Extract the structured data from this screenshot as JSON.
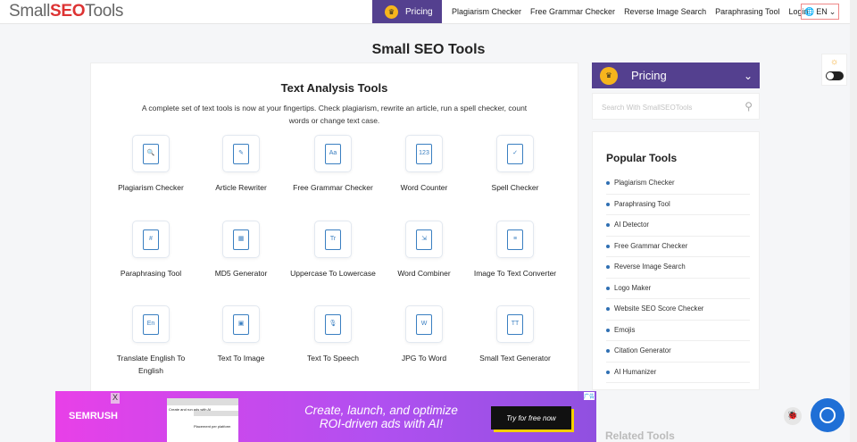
{
  "header": {
    "logo": {
      "pre": "Small",
      "seo": "SEO",
      "post": "Tools"
    },
    "pricing": "Pricing",
    "links": [
      "Plagiarism Checker",
      "Free Grammar Checker",
      "Reverse Image Search",
      "Paraphrasing Tool",
      "Login"
    ],
    "language": "EN"
  },
  "page_title": "Small SEO Tools",
  "main": {
    "title": "Text Analysis Tools",
    "description": "A complete set of text tools is now at your fingertips. Check plagiarism, rewrite an article, run a spell checker, count words or change text case.",
    "tools": [
      {
        "label": "Plagiarism Checker",
        "glyph": "🔍"
      },
      {
        "label": "Article Rewriter",
        "glyph": "✎"
      },
      {
        "label": "Free Grammar Checker",
        "glyph": "Aa"
      },
      {
        "label": "Word Counter",
        "glyph": "123"
      },
      {
        "label": "Spell Checker",
        "glyph": "✓"
      },
      {
        "label": "Paraphrasing Tool",
        "glyph": "#"
      },
      {
        "label": "MD5 Generator",
        "glyph": "▦"
      },
      {
        "label": "Uppercase To Lowercase",
        "glyph": "Tr"
      },
      {
        "label": "Word Combiner",
        "glyph": "⇲"
      },
      {
        "label": "Image To Text Converter",
        "glyph": "≡"
      },
      {
        "label": "Translate English To English",
        "glyph": "En"
      },
      {
        "label": "Text To Image",
        "glyph": "▣"
      },
      {
        "label": "Text To Speech",
        "glyph": "🎙"
      },
      {
        "label": "JPG To Word",
        "glyph": "W"
      },
      {
        "label": "Small Text Generator",
        "glyph": "TT"
      }
    ]
  },
  "sidebar": {
    "pricing": "Pricing",
    "search_placeholder": "Search With SmallSEOTools",
    "popular_title": "Popular Tools",
    "popular": [
      "Plagiarism Checker",
      "Paraphrasing Tool",
      "AI Detector",
      "Free Grammar Checker",
      "Reverse Image Search",
      "Logo Maker",
      "Website SEO Score Checker",
      "Emojis",
      "Citation Generator",
      "AI Humanizer"
    ],
    "related_title": "Related Tools"
  },
  "ad": {
    "close": "X",
    "brand": "SEMRUSH",
    "mock_title": "Create and run ads with AI",
    "mock2_title": "Placement per platform",
    "headline": "Create, launch, and optimize ROI-driven ads with AI!",
    "cta": "Try for free now",
    "info": "广告"
  },
  "colors": {
    "brand_purple": "#54408f",
    "accent_blue": "#3a7fc1",
    "chat_blue": "#1f6fd6"
  }
}
